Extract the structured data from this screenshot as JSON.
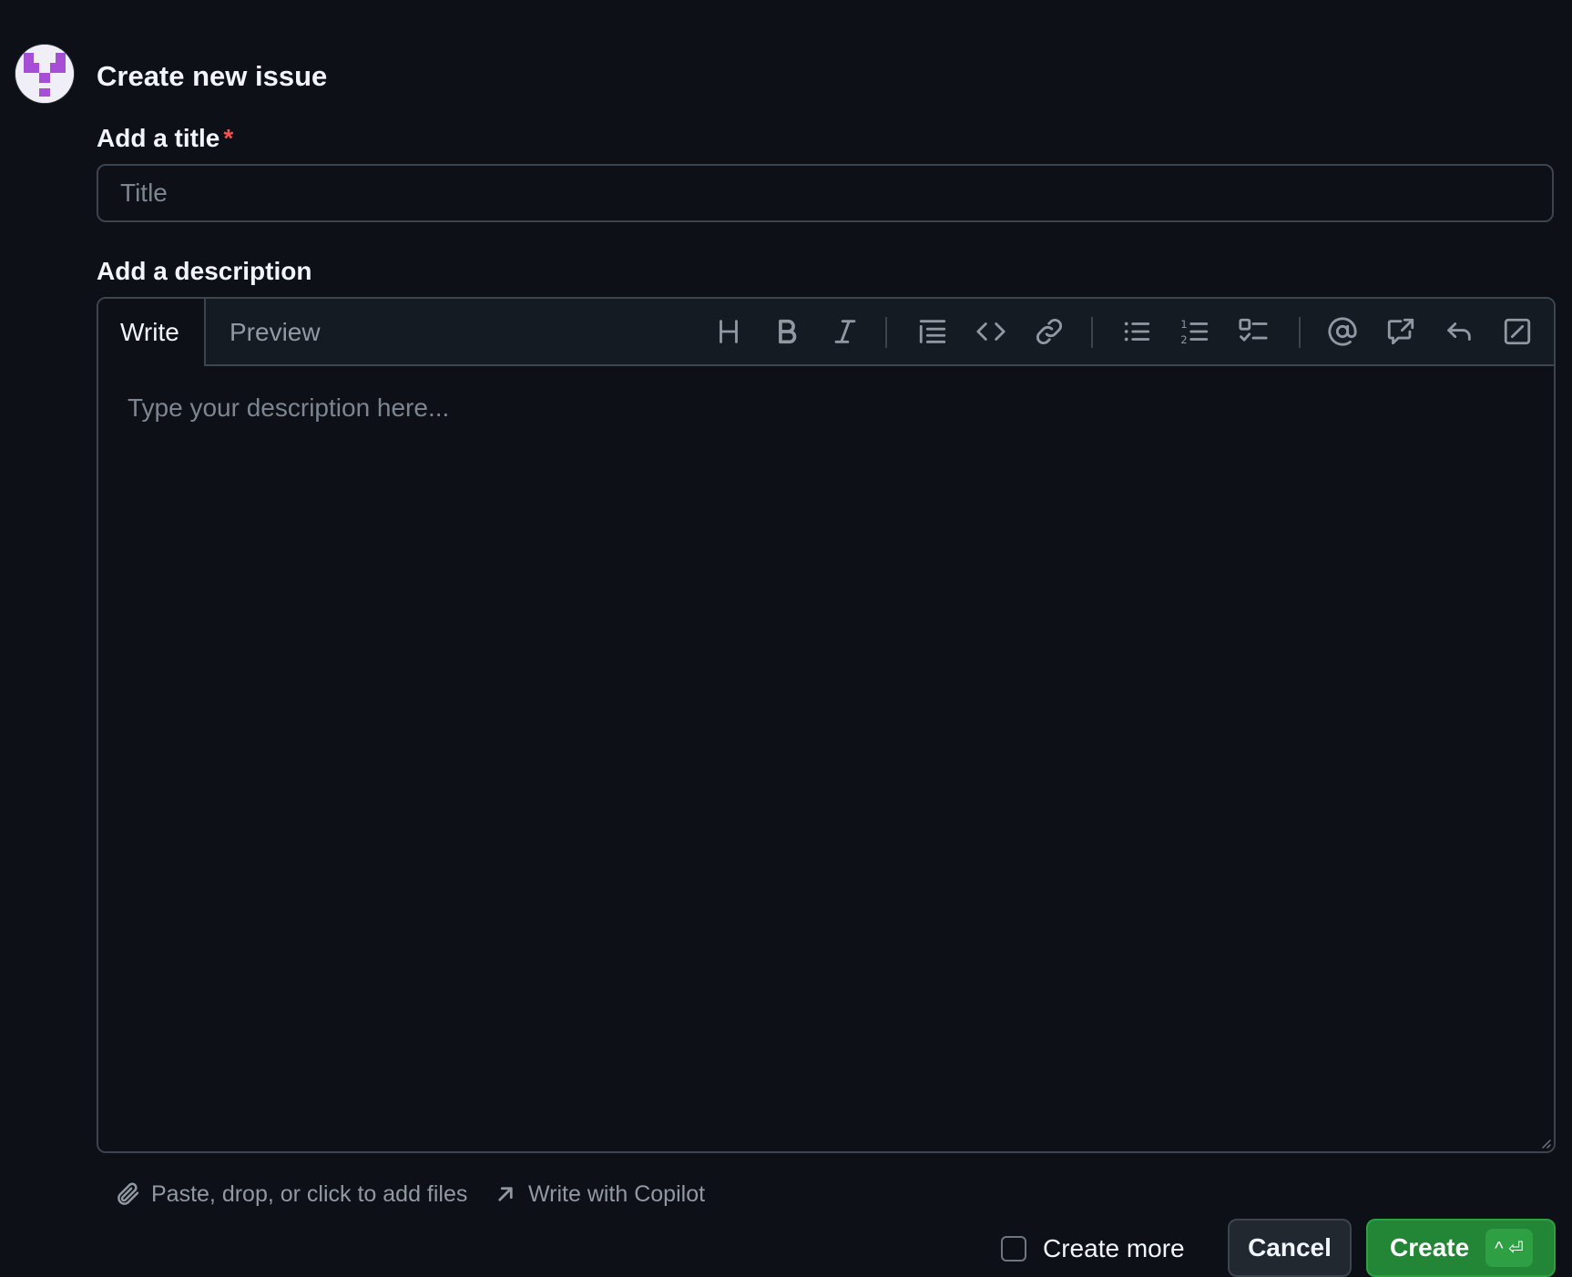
{
  "header": {
    "title": "Create new issue"
  },
  "title_field": {
    "label": "Add a title",
    "required_marker": "*",
    "placeholder": "Title",
    "value": ""
  },
  "description": {
    "label": "Add a description",
    "tabs": [
      {
        "label": "Write",
        "active": true
      },
      {
        "label": "Preview",
        "active": false
      }
    ],
    "placeholder": "Type your description here...",
    "value": "",
    "toolbar": [
      "heading-icon",
      "bold-icon",
      "italic-icon",
      "quote-icon",
      "code-icon",
      "link-icon",
      "unordered-list-icon",
      "ordered-list-icon",
      "task-list-icon",
      "mention-icon",
      "cross-reference-icon",
      "saved-replies-icon",
      "slash-commands-icon"
    ]
  },
  "footer": {
    "attach_label": "Paste, drop, or click to add files",
    "copilot_label": "Write with Copilot",
    "create_more_label": "Create more",
    "create_more_checked": false,
    "cancel_label": "Cancel",
    "create_label": "Create",
    "create_shortcut": "^ ⏎"
  },
  "colors": {
    "background": "#0d1117",
    "accent_green": "#238636",
    "required_red": "#f85149",
    "avatar_purple": "#a64fd6"
  }
}
